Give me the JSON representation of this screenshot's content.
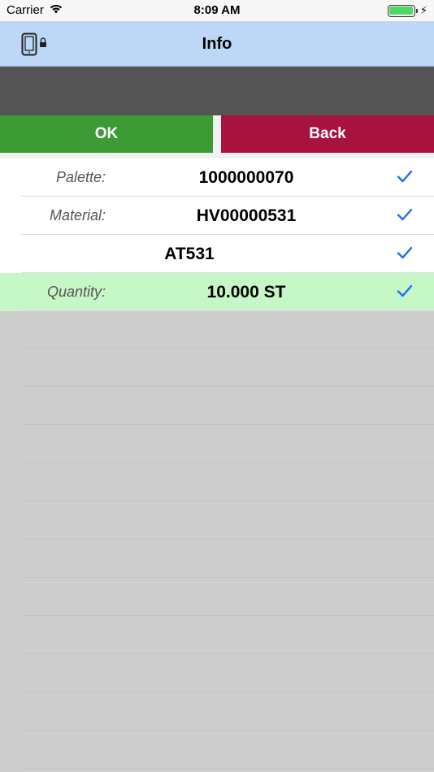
{
  "status_bar": {
    "carrier": "Carrier",
    "time": "8:09 AM",
    "icons": [
      "wifi-icon",
      "battery-icon",
      "charging-bolt-icon"
    ],
    "battery_color": "#4cd964"
  },
  "nav": {
    "title": "Info",
    "left_icon": "device-lock-icon",
    "background": "#bcd8f6"
  },
  "buttons": {
    "ok_label": "OK",
    "back_label": "Back",
    "ok_color": "#3d9b35",
    "back_color": "#a8123e"
  },
  "rows": [
    {
      "label": "Palette:",
      "value": "1000000070",
      "checked": true
    },
    {
      "label": "Material:",
      "value": "HV00000531",
      "checked": true
    },
    {
      "label": "",
      "value": "AT531",
      "checked": true
    },
    {
      "label": "Quantity:",
      "value": "10.000 ST",
      "checked": true,
      "highlight_color": "#c6f7c6"
    }
  ],
  "colors": {
    "check": "#1a6dff",
    "empty_area": "#cdcdcd"
  }
}
